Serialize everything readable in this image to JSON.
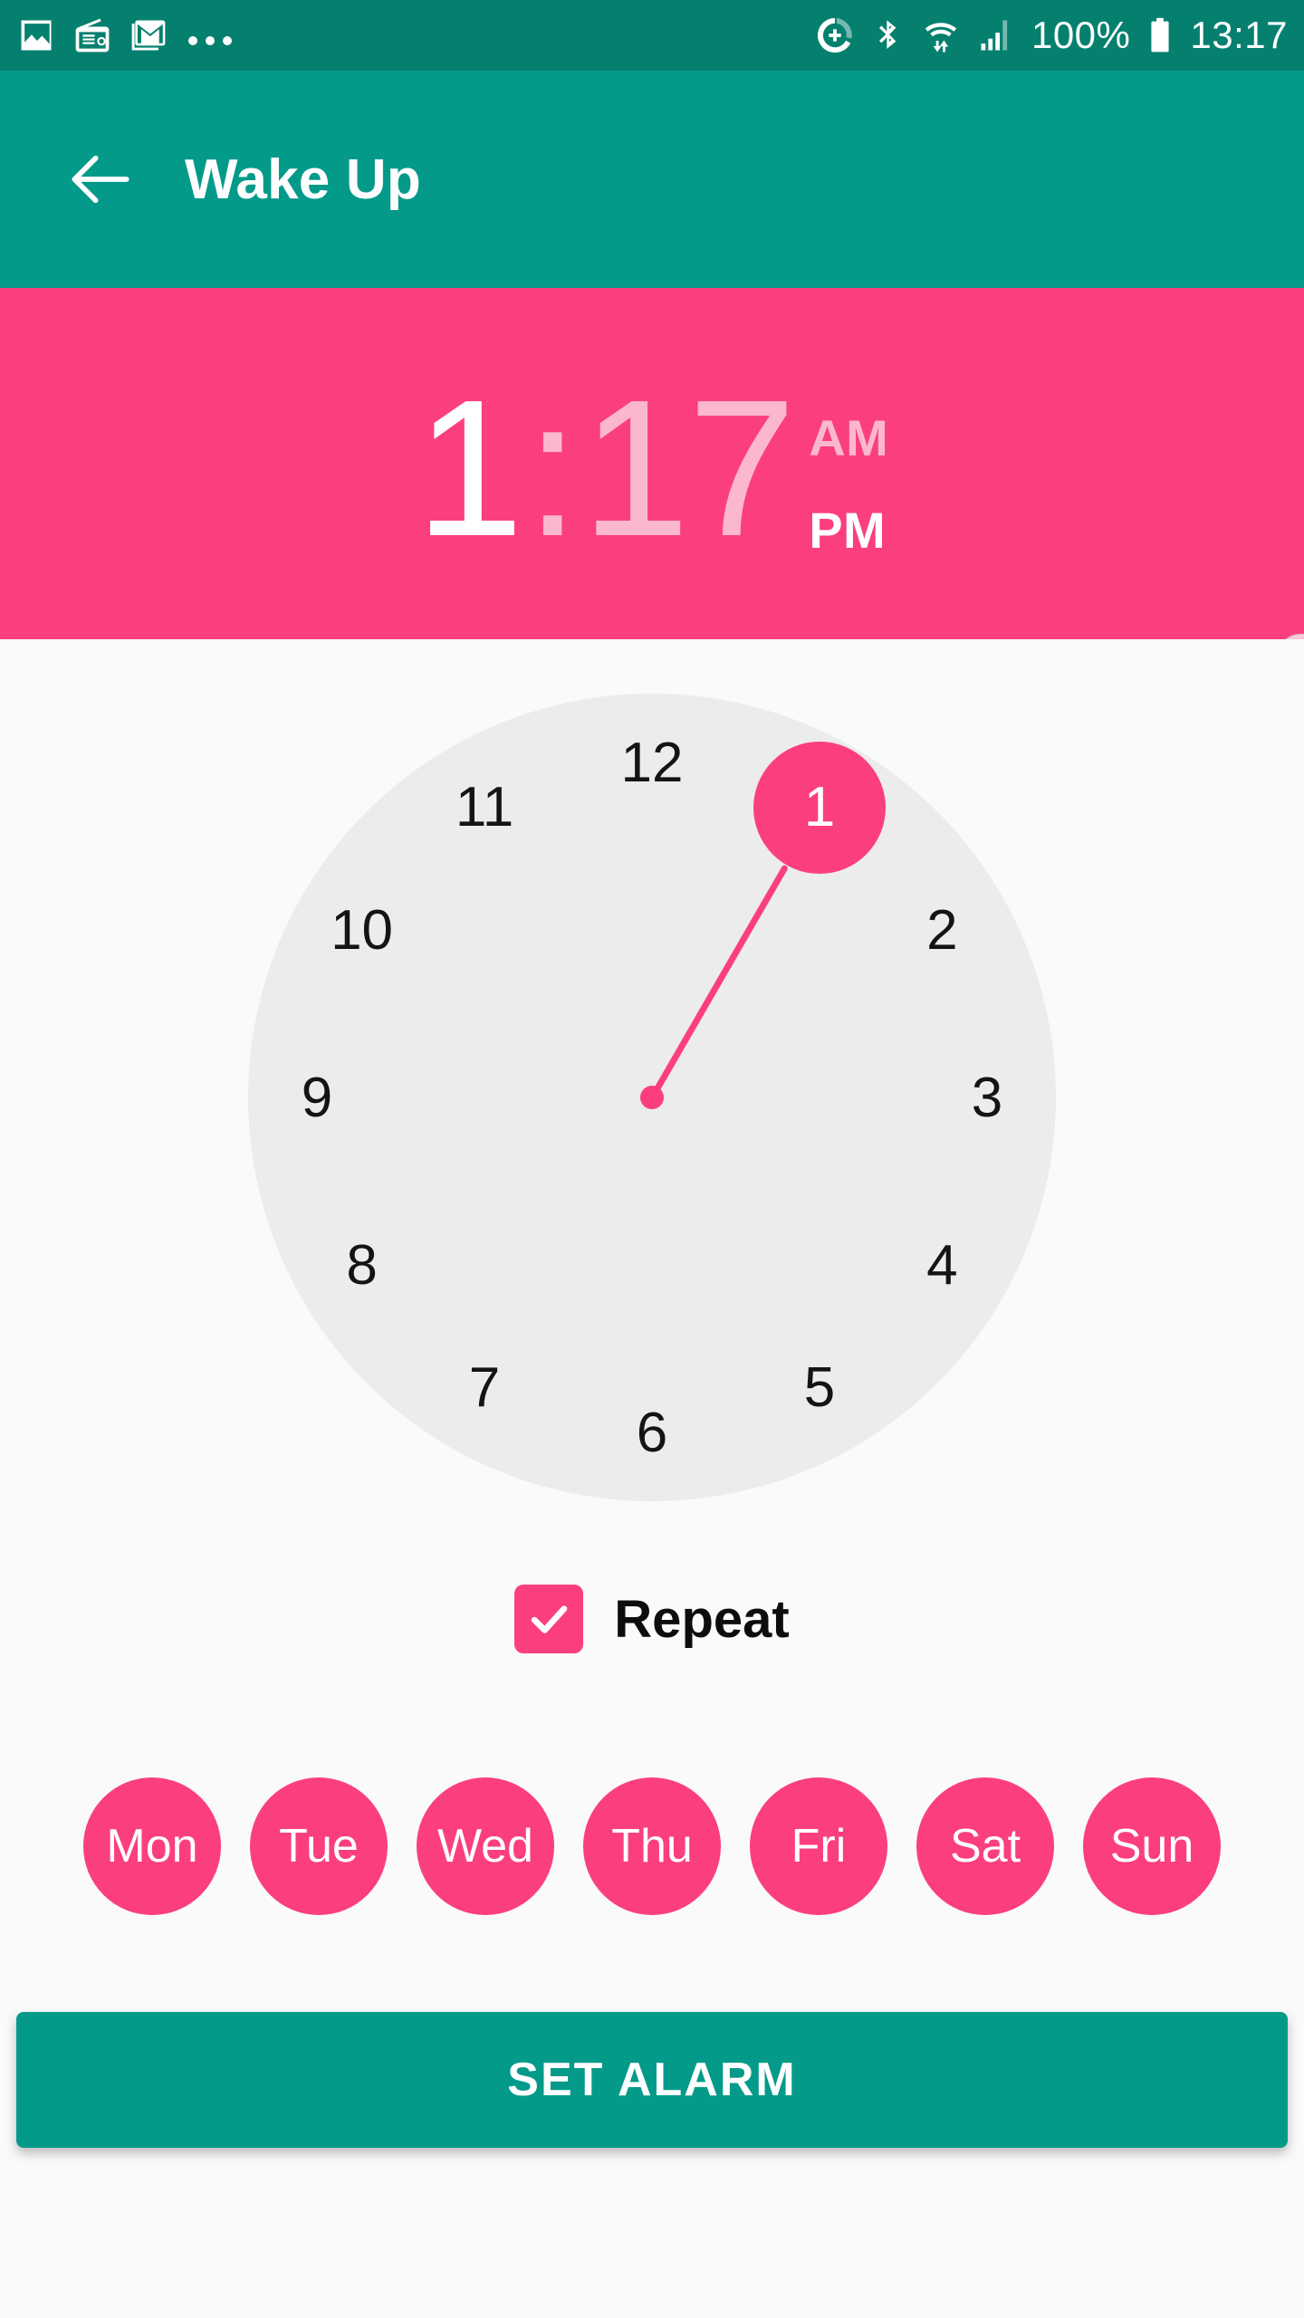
{
  "status_bar": {
    "background": "#05806F",
    "left_icons": [
      {
        "name": "gallery-icon",
        "label": "Gallery"
      },
      {
        "name": "radio-icon",
        "label": "Radio"
      },
      {
        "name": "gmail-icon",
        "label": "Gmail"
      },
      {
        "name": "more-notifications-icon",
        "label": "..."
      }
    ],
    "right_icons": [
      {
        "name": "data-saver-icon",
        "label": "Data saver"
      },
      {
        "name": "bluetooth-icon",
        "label": "Bluetooth"
      },
      {
        "name": "wifi-icon",
        "label": "Wi-Fi"
      },
      {
        "name": "signal-icon",
        "label": "Cellular signal"
      },
      {
        "name": "battery-icon",
        "label": "Battery"
      }
    ],
    "battery_percent": "100%",
    "clock": "13:17"
  },
  "app_bar": {
    "background": "#049A8A",
    "back_icon": "arrow-left-icon",
    "title": "Wake Up"
  },
  "time_header": {
    "background": "#FB3F7E",
    "hour": "1",
    "separator": ":",
    "minute": "17",
    "am_label": "AM",
    "pm_label": "PM",
    "selected_period": "PM",
    "selected_field": "hour",
    "active_color": "#FFFFFF",
    "inactive_color": "#FBB8CC"
  },
  "clock": {
    "face_color": "#ECECEC",
    "accent_color": "#FB3F7E",
    "numbers": [
      "12",
      "1",
      "2",
      "3",
      "4",
      "5",
      "6",
      "7",
      "8",
      "9",
      "10",
      "11"
    ],
    "selected_number": "1",
    "hand_angle_deg": -60
  },
  "repeat": {
    "checked": true,
    "label": "Repeat",
    "check_icon": "check-icon",
    "color": "#FB3F7E"
  },
  "days": [
    {
      "label": "Mon",
      "selected": true
    },
    {
      "label": "Tue",
      "selected": true
    },
    {
      "label": "Wed",
      "selected": true
    },
    {
      "label": "Thu",
      "selected": true
    },
    {
      "label": "Fri",
      "selected": true
    },
    {
      "label": "Sat",
      "selected": true
    },
    {
      "label": "Sun",
      "selected": true
    }
  ],
  "primary_button": {
    "label": "SET ALARM",
    "color": "#049A8A"
  }
}
